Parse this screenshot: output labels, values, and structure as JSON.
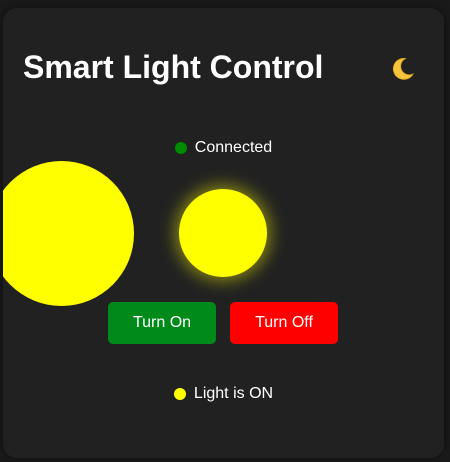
{
  "app": {
    "title": "Smart Light Control"
  },
  "theme_toggle": {
    "icon": "crescent-moon-icon"
  },
  "connection": {
    "status_text": "Connected",
    "dot_color": "#008a00"
  },
  "bulb": {
    "state": "on",
    "color": "#ffff00"
  },
  "controls": {
    "turn_on_label": "Turn On",
    "turn_off_label": "Turn Off",
    "turn_on_color": "#008a1a",
    "turn_off_color": "#ff0000"
  },
  "light_status": {
    "text": "Light is ON",
    "dot_color": "#ffff00"
  },
  "colors": {
    "background": "#1a1a1a",
    "card": "#212121",
    "text": "#ffffff"
  }
}
